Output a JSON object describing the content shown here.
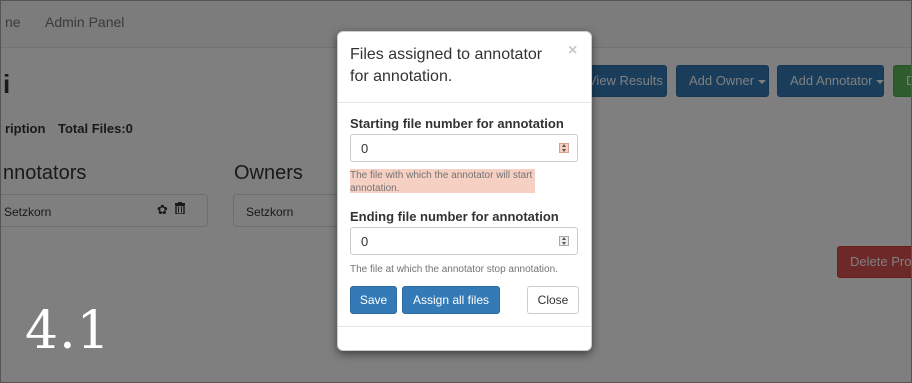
{
  "navbar": {
    "home_fragment": "ne",
    "admin_panel": "Admin Panel"
  },
  "page": {
    "title_fragment": "i"
  },
  "toolbar": {
    "view_results": "View Results",
    "add_owner": "Add Owner",
    "add_annotator": "Add Annotator",
    "cut_button": "D"
  },
  "project": {
    "description_label": "ription",
    "total_files": "Total Files:0"
  },
  "annotators": {
    "heading": "nnotators",
    "item": "Setzkorn",
    "settings_icon": "gear-icon",
    "delete_icon": "trash-icon"
  },
  "owners": {
    "heading": "Owners",
    "item": "Setzkorn"
  },
  "delete_project": "Delete Proje",
  "overlay_number": "4.1",
  "modal": {
    "title": "Files assigned to annotator for annotation.",
    "close_symbol": "×",
    "start_label": "Starting file number for annotation",
    "start_value": "0",
    "start_help": "The file with which the annotator will start annotation.",
    "end_label": "Ending file number for annotation",
    "end_value": "0",
    "end_help": "The file at which the annotator stop annotation.",
    "save": "Save",
    "assign_all": "Assign all files",
    "close": "Close"
  },
  "colors": {
    "primary": "#337ab7",
    "success": "#5cb85c",
    "danger": "#d9534f",
    "highlight": "#f6d0c2"
  }
}
